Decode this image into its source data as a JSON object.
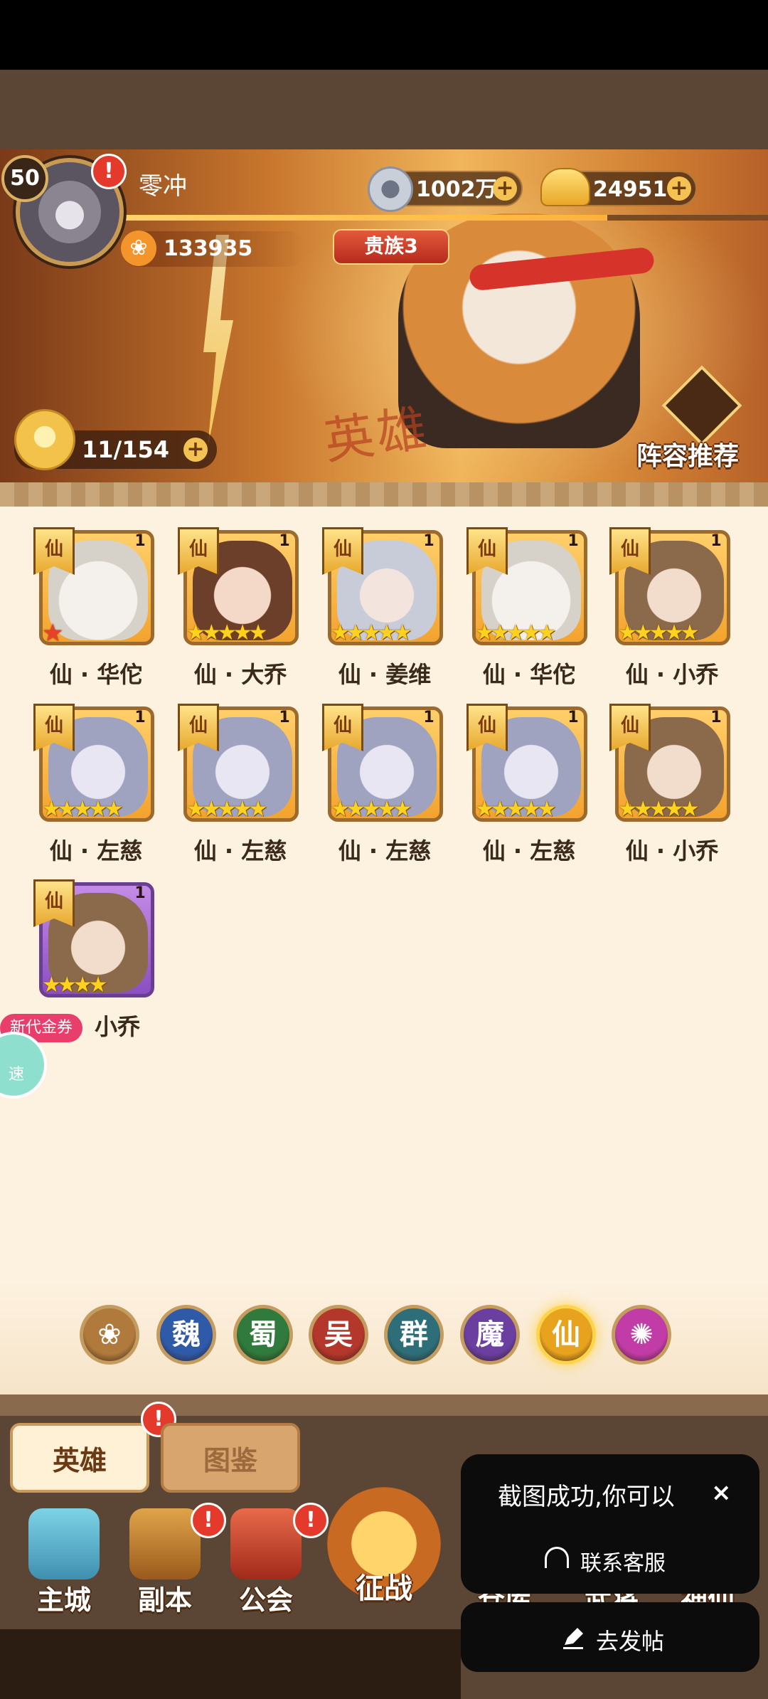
{
  "player": {
    "level": "50",
    "name": "零冲",
    "power": "133935",
    "noble": "贵族3"
  },
  "currency": {
    "copper": "1002万",
    "gold": "24951"
  },
  "hero_count": "11/154",
  "banner_text": "英雄",
  "lineup_label": "阵容推荐",
  "heroes": [
    {
      "name": "仙 · 华佗",
      "faction": "仙",
      "level": "1",
      "stars": "★",
      "portrait": "huatuo"
    },
    {
      "name": "仙 · 大乔",
      "faction": "仙",
      "level": "1",
      "stars": "★★★★★",
      "portrait": "daqiao"
    },
    {
      "name": "仙 · 姜维",
      "faction": "仙",
      "level": "1",
      "stars": "★★★★★",
      "portrait": "jiangwei"
    },
    {
      "name": "仙 · 华佗",
      "faction": "仙",
      "level": "1",
      "stars": "★★★★★",
      "portrait": "huatuo"
    },
    {
      "name": "仙 · 小乔",
      "faction": "仙",
      "level": "1",
      "stars": "★★★★★",
      "portrait": "xiaoqiao"
    },
    {
      "name": "仙 · 左慈",
      "faction": "仙",
      "level": "1",
      "stars": "★★★★★",
      "portrait": "zuoci"
    },
    {
      "name": "仙 · 左慈",
      "faction": "仙",
      "level": "1",
      "stars": "★★★★★",
      "portrait": "zuoci"
    },
    {
      "name": "仙 · 左慈",
      "faction": "仙",
      "level": "1",
      "stars": "★★★★★",
      "portrait": "zuoci"
    },
    {
      "name": "仙 · 左慈",
      "faction": "仙",
      "level": "1",
      "stars": "★★★★★",
      "portrait": "zuoci"
    },
    {
      "name": "仙 · 小乔",
      "faction": "仙",
      "level": "1",
      "stars": "★★★★★",
      "portrait": "xiaoqiao"
    },
    {
      "name": "小乔",
      "faction": "仙",
      "level": "1",
      "stars": "★★★★",
      "portrait": "xiaoqiao"
    }
  ],
  "promo": {
    "label": "新代金券",
    "speed_label": "速"
  },
  "filters": [
    {
      "label": "",
      "icon": "paw-icon",
      "color": "#b07a3c"
    },
    {
      "label": "魏",
      "color": "#2f5aa8"
    },
    {
      "label": "蜀",
      "color": "#2f7a3c"
    },
    {
      "label": "吴",
      "color": "#b4372c"
    },
    {
      "label": "群",
      "color": "#2d6e78"
    },
    {
      "label": "魔",
      "color": "#6a3fa0"
    },
    {
      "label": "仙",
      "color": "#e7a21e",
      "active": true
    },
    {
      "label": "",
      "icon": "swirl-icon",
      "color": "#c23ca8"
    }
  ],
  "tabs": {
    "hero": "英雄",
    "guide": "图鉴"
  },
  "nav": {
    "main_city": "主城",
    "dungeon": "副本",
    "guild": "公会",
    "campaign": "征战",
    "warehouse": "仓库",
    "generals": "武将",
    "gods": "神仙"
  },
  "toast": {
    "message": "截图成功,你可以",
    "close": "×",
    "service": "联系客服",
    "post": "去发帖"
  },
  "alert_mark": "!"
}
